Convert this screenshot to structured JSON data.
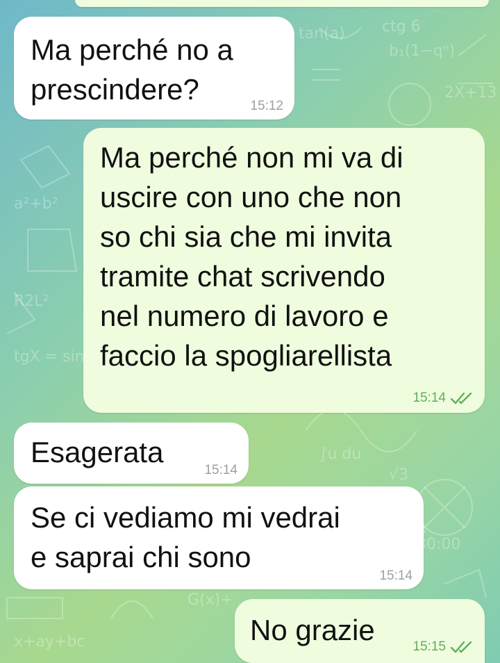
{
  "colors": {
    "incoming_bubble": "#ffffff",
    "outgoing_bubble": "#effdde",
    "read_ticks": "#5db05b",
    "timestamp_gray": "#9aa0a6"
  },
  "messages": [
    {
      "direction": "incoming",
      "text": "Ma perché no a\nprescindere?",
      "time": "15:12"
    },
    {
      "direction": "outgoing",
      "text": "Ma perché non mi va di\nuscire con uno che non\nso chi sia che mi invita\ntramite chat scrivendo\nnel numero di lavoro e\nfaccio la spogliarellista",
      "time": "15:14",
      "status_icon": "double-check-icon"
    },
    {
      "direction": "incoming",
      "text": "Esagerata",
      "time": "15:14"
    },
    {
      "direction": "incoming",
      "text": "Se ci vediamo mi vedrai\ne saprai chi sono",
      "time": "15:14"
    },
    {
      "direction": "outgoing",
      "text": "No grazie",
      "time": "15:15",
      "status_icon": "double-check-icon"
    }
  ]
}
